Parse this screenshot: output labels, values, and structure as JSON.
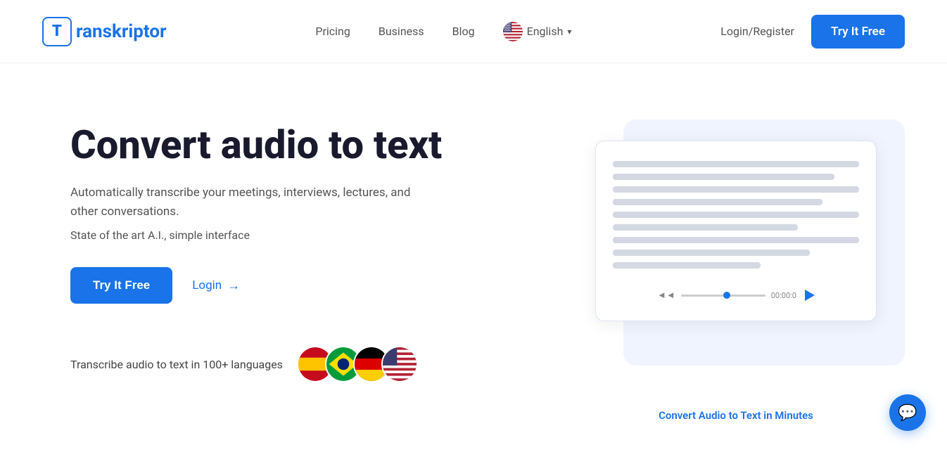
{
  "brand": {
    "logo_letter": "T",
    "logo_name": "ranskriptor"
  },
  "nav": {
    "links": [
      {
        "label": "Pricing",
        "id": "pricing"
      },
      {
        "label": "Business",
        "id": "business"
      },
      {
        "label": "Blog",
        "id": "blog"
      }
    ],
    "language": "English",
    "login_label": "Login/Register",
    "try_free_label": "Try It Free"
  },
  "hero": {
    "title": "Convert audio to text",
    "description": "Automatically transcribe your meetings, interviews, lectures, and other conversations.",
    "tagline": "State of the art A.I., simple interface",
    "try_free_label": "Try It Free",
    "login_label": "Login",
    "languages_text": "Transcribe audio to text in 100+ languages",
    "card_caption": "Convert Audio to Text in Minutes"
  },
  "chat": {
    "icon": "💬"
  }
}
